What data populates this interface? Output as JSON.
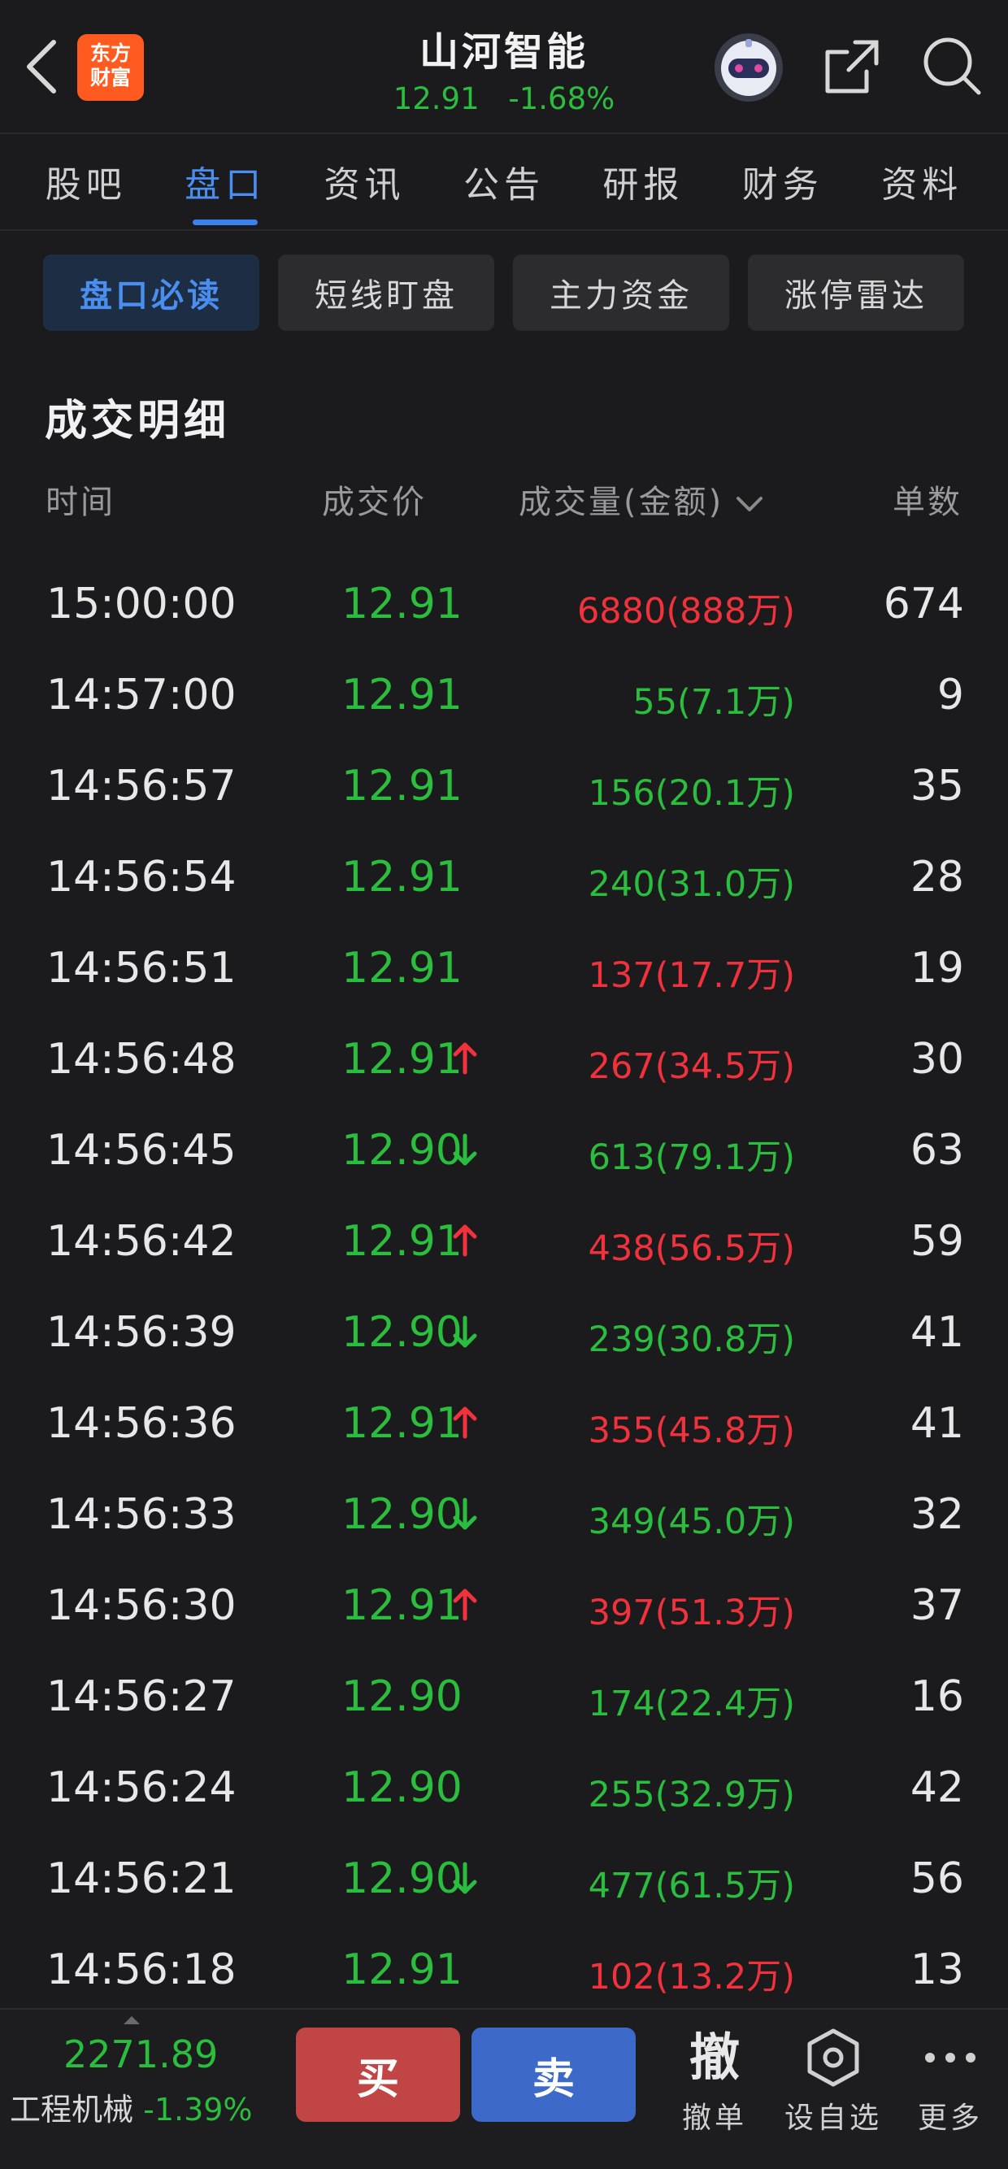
{
  "header": {
    "app_logo": [
      "东方",
      "财富"
    ],
    "title": "山河智能",
    "price": "12.91",
    "change_pct": "-1.68%",
    "icons": [
      "back-icon",
      "robot-avatar-icon",
      "share-icon",
      "search-icon"
    ]
  },
  "tabs": [
    {
      "label": "股吧",
      "active": false
    },
    {
      "label": "盘口",
      "active": true
    },
    {
      "label": "资讯",
      "active": false
    },
    {
      "label": "公告",
      "active": false
    },
    {
      "label": "研报",
      "active": false
    },
    {
      "label": "财务",
      "active": false
    },
    {
      "label": "资料",
      "active": false
    }
  ],
  "subtabs": [
    {
      "label": "盘口必读",
      "active": true
    },
    {
      "label": "短线盯盘",
      "active": false
    },
    {
      "label": "主力资金",
      "active": false
    },
    {
      "label": "涨停雷达",
      "active": false
    }
  ],
  "section": {
    "title": "成交明细",
    "columns": {
      "time": "时间",
      "price": "成交价",
      "volume": "成交量(金额)",
      "count": "单数"
    }
  },
  "trades": [
    {
      "time": "15:00:00",
      "price": "12.91",
      "arrow": "",
      "volume": "6880(888万)",
      "volume_color": "red",
      "count": "674"
    },
    {
      "time": "14:57:00",
      "price": "12.91",
      "arrow": "",
      "volume": "55(7.1万)",
      "volume_color": "green",
      "count": "9"
    },
    {
      "time": "14:56:57",
      "price": "12.91",
      "arrow": "",
      "volume": "156(20.1万)",
      "volume_color": "green",
      "count": "35"
    },
    {
      "time": "14:56:54",
      "price": "12.91",
      "arrow": "",
      "volume": "240(31.0万)",
      "volume_color": "green",
      "count": "28"
    },
    {
      "time": "14:56:51",
      "price": "12.91",
      "arrow": "",
      "volume": "137(17.7万)",
      "volume_color": "red",
      "count": "19"
    },
    {
      "time": "14:56:48",
      "price": "12.91",
      "arrow": "up",
      "volume": "267(34.5万)",
      "volume_color": "red",
      "count": "30"
    },
    {
      "time": "14:56:45",
      "price": "12.90",
      "arrow": "down",
      "volume": "613(79.1万)",
      "volume_color": "green",
      "count": "63"
    },
    {
      "time": "14:56:42",
      "price": "12.91",
      "arrow": "up",
      "volume": "438(56.5万)",
      "volume_color": "red",
      "count": "59"
    },
    {
      "time": "14:56:39",
      "price": "12.90",
      "arrow": "down",
      "volume": "239(30.8万)",
      "volume_color": "green",
      "count": "41"
    },
    {
      "time": "14:56:36",
      "price": "12.91",
      "arrow": "up",
      "volume": "355(45.8万)",
      "volume_color": "red",
      "count": "41"
    },
    {
      "time": "14:56:33",
      "price": "12.90",
      "arrow": "down",
      "volume": "349(45.0万)",
      "volume_color": "green",
      "count": "32"
    },
    {
      "time": "14:56:30",
      "price": "12.91",
      "arrow": "up",
      "volume": "397(51.3万)",
      "volume_color": "red",
      "count": "37"
    },
    {
      "time": "14:56:27",
      "price": "12.90",
      "arrow": "",
      "volume": "174(22.4万)",
      "volume_color": "green",
      "count": "16"
    },
    {
      "time": "14:56:24",
      "price": "12.90",
      "arrow": "",
      "volume": "255(32.9万)",
      "volume_color": "green",
      "count": "42"
    },
    {
      "time": "14:56:21",
      "price": "12.90",
      "arrow": "down",
      "volume": "477(61.5万)",
      "volume_color": "green",
      "count": "56"
    },
    {
      "time": "14:56:18",
      "price": "12.91",
      "arrow": "",
      "volume": "102(13.2万)",
      "volume_color": "red",
      "count": "13"
    }
  ],
  "bottom": {
    "index_value": "2271.89",
    "index_name": "工程机械",
    "index_change": "-1.39%",
    "buy_label": "买",
    "sell_label": "卖",
    "cancel_icon_char": "撤",
    "cancel_label": "撤单",
    "watchlist_label": "设自选",
    "more_label": "更多"
  },
  "colors": {
    "background": "#1b1b1d",
    "up_red": "#f1323c",
    "down_green": "#2bbd3e",
    "accent_blue": "#4a8ff0",
    "buy_button": "#c14545",
    "sell_button": "#3d69c8"
  }
}
